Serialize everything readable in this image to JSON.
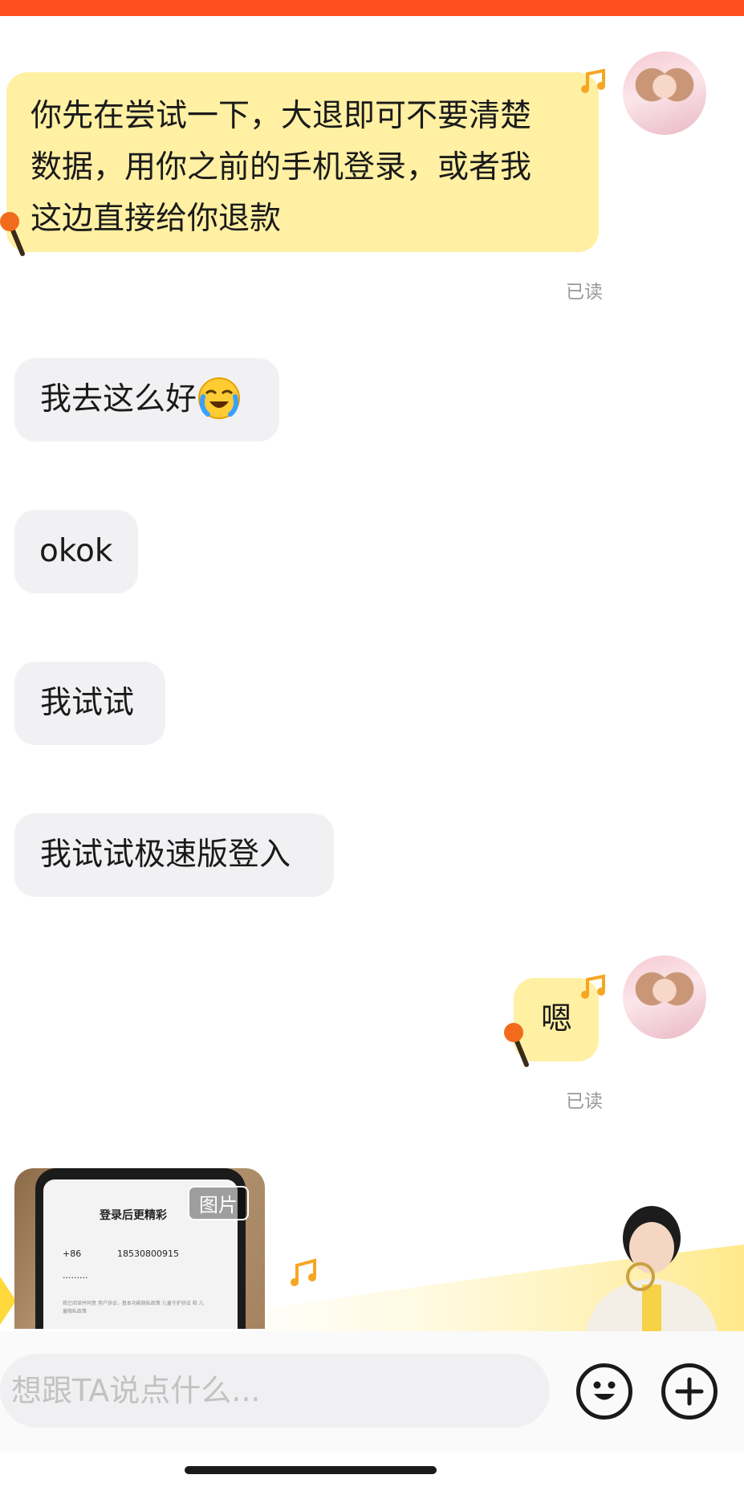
{
  "messages": [
    {
      "side": "out",
      "text_lines": [
        "你先在尝试一下，大退即可不要清楚",
        "数据，用你之前的手机登录，或者我",
        "这边直接给你退款"
      ],
      "status": "已读"
    },
    {
      "side": "in",
      "text": "我去这么好",
      "emoji": "loudly-crying-laughing-emoji"
    },
    {
      "side": "in",
      "text": "okok"
    },
    {
      "side": "in",
      "text": "我试试"
    },
    {
      "side": "in",
      "text": "我试试极速版登入"
    },
    {
      "side": "out",
      "text": "嗯",
      "status": "已读"
    }
  ],
  "image_message": {
    "tag": "图片",
    "screenshot_text": {
      "title": "登录后更精彩",
      "country_code": "+86",
      "phone": "18530800915",
      "password_mask": "·········",
      "agreement": "我已阅读并同意 用户协议，基本功能隐私政策 儿童守护协议 和 儿童隐私政策"
    }
  },
  "input": {
    "placeholder": "想跟TA说点什么..."
  },
  "icons": {
    "emoji_button": "smiley-face-icon",
    "plus_button": "plus-circle-icon",
    "music_note": "music-note-icon",
    "microphone": "microphone-icon"
  },
  "colors": {
    "top_bar": "#ff4f1f",
    "outgoing_bubble": "#fff0a3",
    "incoming_bubble": "#f1f1f3",
    "accent_yellow": "#fcd94a"
  }
}
